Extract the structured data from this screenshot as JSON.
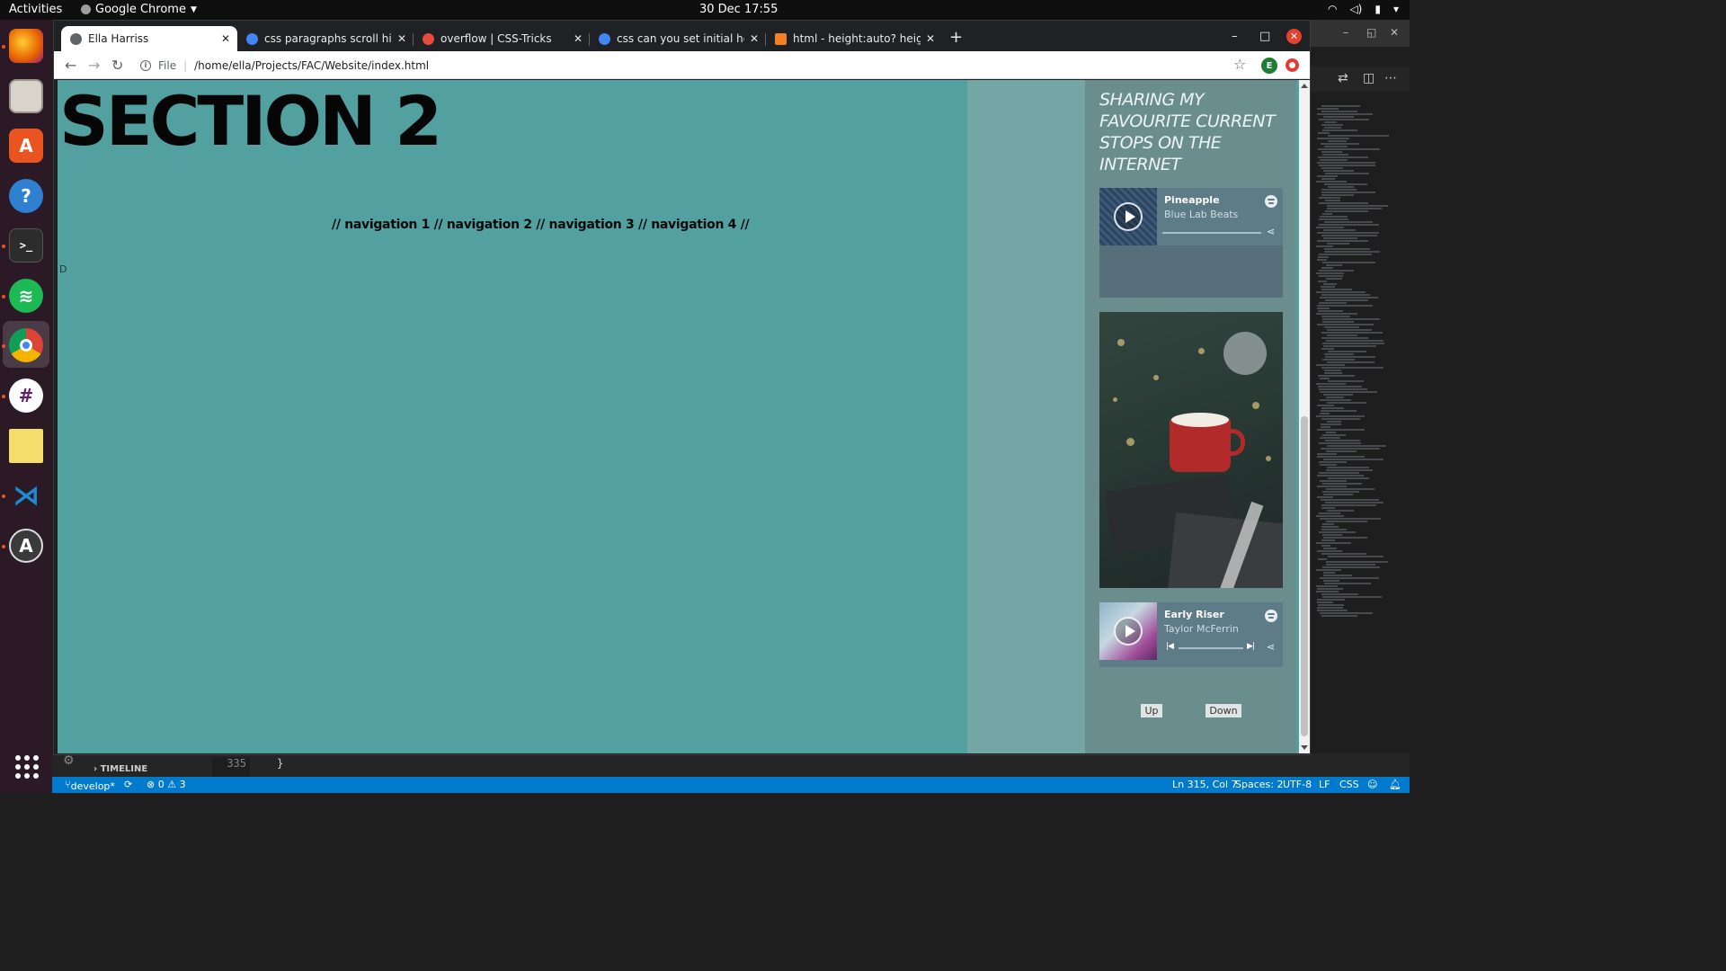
{
  "topbar": {
    "activities": "Activities",
    "app_name": "Google Chrome",
    "clock": "30 Dec  17:55"
  },
  "dock": {
    "items": [
      "firefox-icon",
      "files-icon",
      "software-center-icon",
      "help-icon",
      "terminal-icon",
      "spotify-icon",
      "chrome-icon",
      "slack-icon",
      "sticky-notes-icon",
      "vscode-icon",
      "software-updater-icon"
    ],
    "active": "chrome-icon"
  },
  "chrome": {
    "tabs": [
      {
        "title": "Ella Harriss",
        "active": true,
        "icon_color": "#5f6368"
      },
      {
        "title": "css paragraphs scroll hide",
        "active": false,
        "icon_color": "#4285f4"
      },
      {
        "title": "overflow | CSS-Tricks",
        "active": false,
        "icon_color": "#e84a3c"
      },
      {
        "title": "css can you set initial heig",
        "active": false,
        "icon_color": "#4285f4"
      },
      {
        "title": "html - height:auto? height",
        "active": false,
        "icon_color": "#f48024"
      }
    ],
    "new_tab": "+",
    "url_scheme": "File",
    "url": "/home/ella/Projects/FAC/Website/index.html",
    "profile_initial": "E"
  },
  "page": {
    "section_title": "SECTION 2",
    "nav_text": "// navigation 1 // navigation 2 // navigation 3 // navigation 4 //",
    "stray_char": "D",
    "aside_title": "SHARING MY FAVOURITE CURRENT STOPS ON THE INTERNET",
    "players": [
      {
        "track": "Pineapple",
        "artist": "Blue Lab Beats"
      },
      {
        "track": "Early Riser",
        "artist": "Taylor McFerrin"
      }
    ],
    "up_label": "Up",
    "down_label": "Down"
  },
  "vscode": {
    "timeline": "TIMELINE",
    "line_number": "335",
    "code": "}",
    "status": {
      "branch": "develop*",
      "problems": "⊗ 0 ⚠ 3",
      "cursor": "Ln 315, Col 7",
      "spaces": "Spaces: 2",
      "encoding": "UTF-8",
      "eol": "LF",
      "language": "CSS"
    }
  },
  "colors": {
    "page_bg": "#52a09f",
    "aside_bg": "#6a8e8e",
    "vscode_status": "#007acc"
  }
}
